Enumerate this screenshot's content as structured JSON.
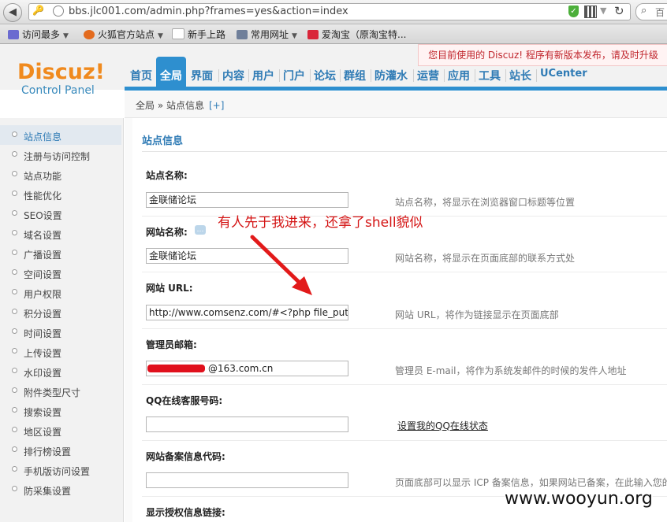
{
  "browser": {
    "url": "bbs.jlc001.com/admin.php?frames=yes&action=index",
    "search_placeholder": "百",
    "bookmarks": [
      {
        "label": "访问最多",
        "color": "#6b6bd0"
      },
      {
        "label": "火狐官方站点",
        "color": "#e36b1e"
      },
      {
        "label": "新手上路",
        "color": "#e6e6e6"
      },
      {
        "label": "常用网址",
        "color": "#6f7f9a"
      },
      {
        "label": "爱淘宝（原淘宝特...",
        "color": "#d9263a"
      }
    ]
  },
  "header": {
    "logo_main": "Discuz!",
    "logo_sub": "Control Panel",
    "notice": "您目前使用的 Discuz! 程序有新版本发布，请及时升级",
    "nav": [
      "首页",
      "全局",
      "界面",
      "内容",
      "用户",
      "门户",
      "论坛",
      "群组",
      "防灌水",
      "运营",
      "应用",
      "工具",
      "站长",
      "UCenter"
    ],
    "active_nav": "全局"
  },
  "breadcrumb": {
    "text": "全局 » 站点信息",
    "plus": "[+]"
  },
  "sidebar": {
    "items": [
      "站点信息",
      "注册与访问控制",
      "站点功能",
      "性能优化",
      "SEO设置",
      "域名设置",
      "广播设置",
      "空间设置",
      "用户权限",
      "积分设置",
      "时间设置",
      "上传设置",
      "水印设置",
      "附件类型尺寸",
      "搜索设置",
      "地区设置",
      "排行榜设置",
      "手机版访问设置",
      "防采集设置"
    ],
    "active_index": 0
  },
  "main": {
    "section_title": "站点信息",
    "fields": [
      {
        "label": "站点名称:",
        "value": "金联储论坛",
        "desc": "站点名称，将显示在浏览器窗口标题等位置"
      },
      {
        "label": "网站名称:",
        "value": "金联储论坛",
        "desc": "网站名称，将显示在页面底部的联系方式处"
      },
      {
        "label": "网站 URL:",
        "value": "http://www.comsenz.com/#<?php file_put",
        "desc": "网站 URL，将作为链接显示在页面底部"
      },
      {
        "label": "管理员邮箱:",
        "value": "@163.com.cn",
        "desc": "管理员 E-mail，将作为系统发邮件的时候的发件人地址"
      },
      {
        "label": "QQ在线客服号码:",
        "value": "",
        "link": "设置我的QQ在线状态"
      },
      {
        "label": "网站备案信息代码:",
        "value": "",
        "desc": "页面底部可以显示 ICP 备案信息，如果网站已备案，在此输入您的"
      },
      {
        "label": "显示授权信息链接:"
      }
    ]
  },
  "annotation": "有人先于我进来，还拿了shell貌似",
  "watermark": "www.wooyun.org"
}
